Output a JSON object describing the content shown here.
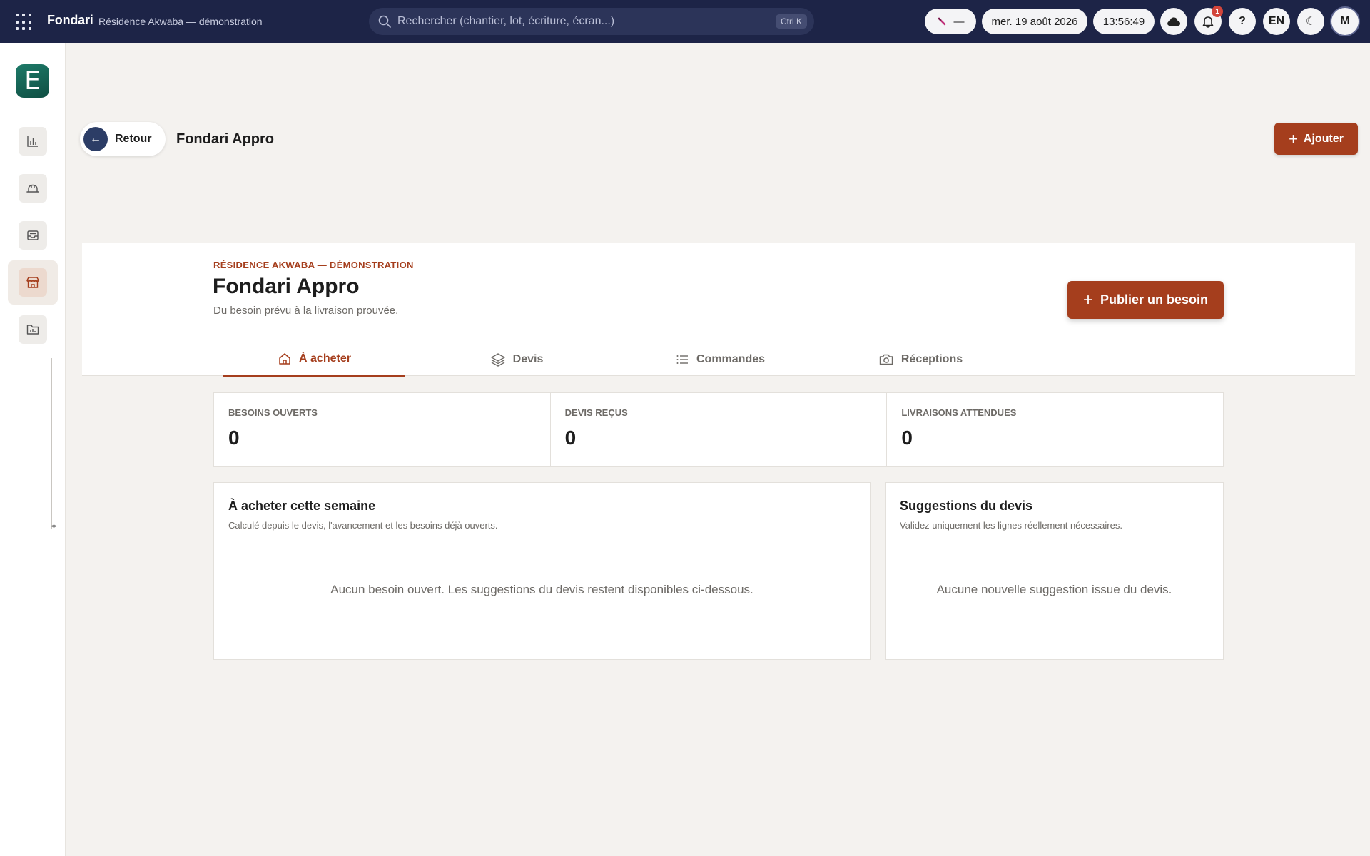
{
  "topbar": {
    "brand": "Fondari",
    "context": "Résidence Akwaba — démonstration",
    "search_placeholder": "Rechercher (chantier, lot, écriture, écran...)",
    "search_shortcut": "Ctrl K",
    "status_pill_text": "—",
    "date": "mer. 19 août 2026",
    "time": "13:56:49",
    "notification_count": "1",
    "help_label": "?",
    "language": "EN",
    "theme_icon": "☾",
    "avatar_initial": "M"
  },
  "sidebar": {
    "logo_letter": "E",
    "items": [
      {
        "icon": "bar-chart-icon"
      },
      {
        "icon": "hard-hat-icon"
      },
      {
        "icon": "inbox-icon"
      },
      {
        "icon": "store-icon",
        "active": true
      },
      {
        "icon": "folder-chart-icon"
      }
    ]
  },
  "header": {
    "back_label": "Retour",
    "title": "Fondari Appro",
    "add_label": "Ajouter"
  },
  "main": {
    "eyebrow": "RÉSIDENCE AKWABA — DÉMONSTRATION",
    "title": "Fondari Appro",
    "subtitle": "Du besoin prévu à la livraison prouvée.",
    "publish_label": "Publier un besoin",
    "tabs": [
      {
        "label": "À acheter",
        "icon": "home-icon",
        "active": true
      },
      {
        "label": "Devis",
        "icon": "layers-icon"
      },
      {
        "label": "Commandes",
        "icon": "list-icon"
      },
      {
        "label": "Réceptions",
        "icon": "camera-icon"
      }
    ]
  },
  "stats": [
    {
      "label": "BESOINS OUVERTS",
      "value": "0"
    },
    {
      "label": "DEVIS REÇUS",
      "value": "0"
    },
    {
      "label": "LIVRAISONS ATTENDUES",
      "value": "0"
    }
  ],
  "cards": {
    "buy_week": {
      "title": "À acheter cette semaine",
      "subtitle": "Calculé depuis le devis, l'avancement et les besoins déjà ouverts.",
      "empty": "Aucun besoin ouvert. Les suggestions du devis restent disponibles ci-dessous."
    },
    "suggestions": {
      "title": "Suggestions du devis",
      "subtitle": "Validez uniquement les lignes réellement nécessaires.",
      "empty": "Aucune nouvelle suggestion issue du devis."
    }
  },
  "colors": {
    "topbar": "#1d2447",
    "accent": "#a53e1d",
    "background": "#f4f2ef",
    "logo": "#1d7a68"
  }
}
